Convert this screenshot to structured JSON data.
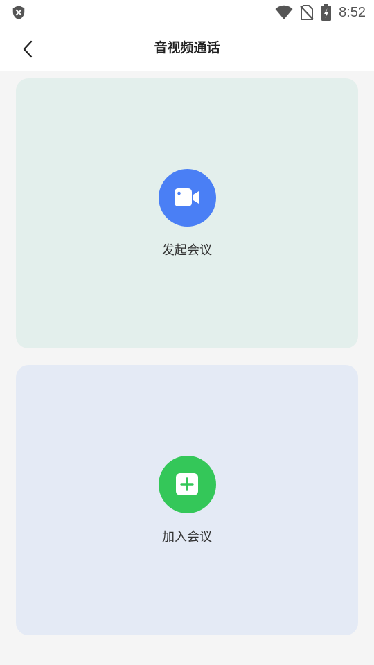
{
  "status_bar": {
    "time": "8:52",
    "icons": [
      "shield-x-icon",
      "wifi-icon",
      "no-sim-icon",
      "battery-charging-icon"
    ]
  },
  "nav": {
    "title": "音视频通话",
    "back_icon": "chevron-left-icon"
  },
  "cards": {
    "start_meeting": {
      "label": "发起会议",
      "icon": "video-camera-icon",
      "icon_bg": "#4a7ff5",
      "card_bg": "#e3efec"
    },
    "join_meeting": {
      "label": "加入会议",
      "icon": "plus-square-icon",
      "icon_bg": "#34c759",
      "card_bg": "#e4eaf5"
    }
  }
}
